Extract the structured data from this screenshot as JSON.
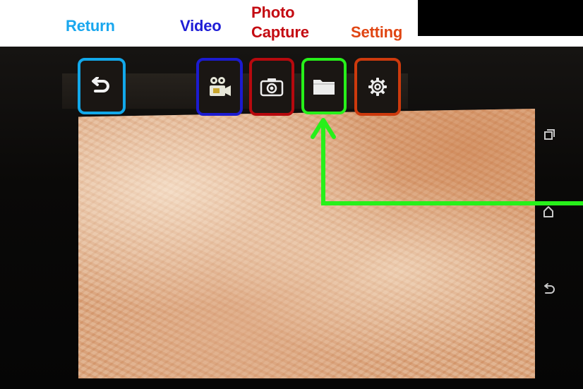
{
  "labels": {
    "return": "Return",
    "video": "Video",
    "photo_line1": "Photo",
    "photo_line2": "Capture",
    "setting": "Setting"
  },
  "toolbar": [
    {
      "name": "return-button",
      "icon": "return-arrow-icon",
      "border_color": "#12a8ea"
    },
    {
      "name": "video-button",
      "icon": "video-camera-icon",
      "border_color": "#1c1bd0"
    },
    {
      "name": "photo-capture-button",
      "icon": "camera-icon",
      "border_color": "#b7090e"
    },
    {
      "name": "folder-button",
      "icon": "folder-icon",
      "border_color": "#27f01a"
    },
    {
      "name": "setting-button",
      "icon": "gear-icon",
      "border_color": "#cd3a0d"
    }
  ],
  "system_nav": [
    {
      "name": "recent-apps-button",
      "icon": "recent-apps-icon"
    },
    {
      "name": "home-button",
      "icon": "home-icon"
    },
    {
      "name": "back-button",
      "icon": "back-icon"
    }
  ],
  "annotation": {
    "arrow_color": "#27f01a"
  }
}
